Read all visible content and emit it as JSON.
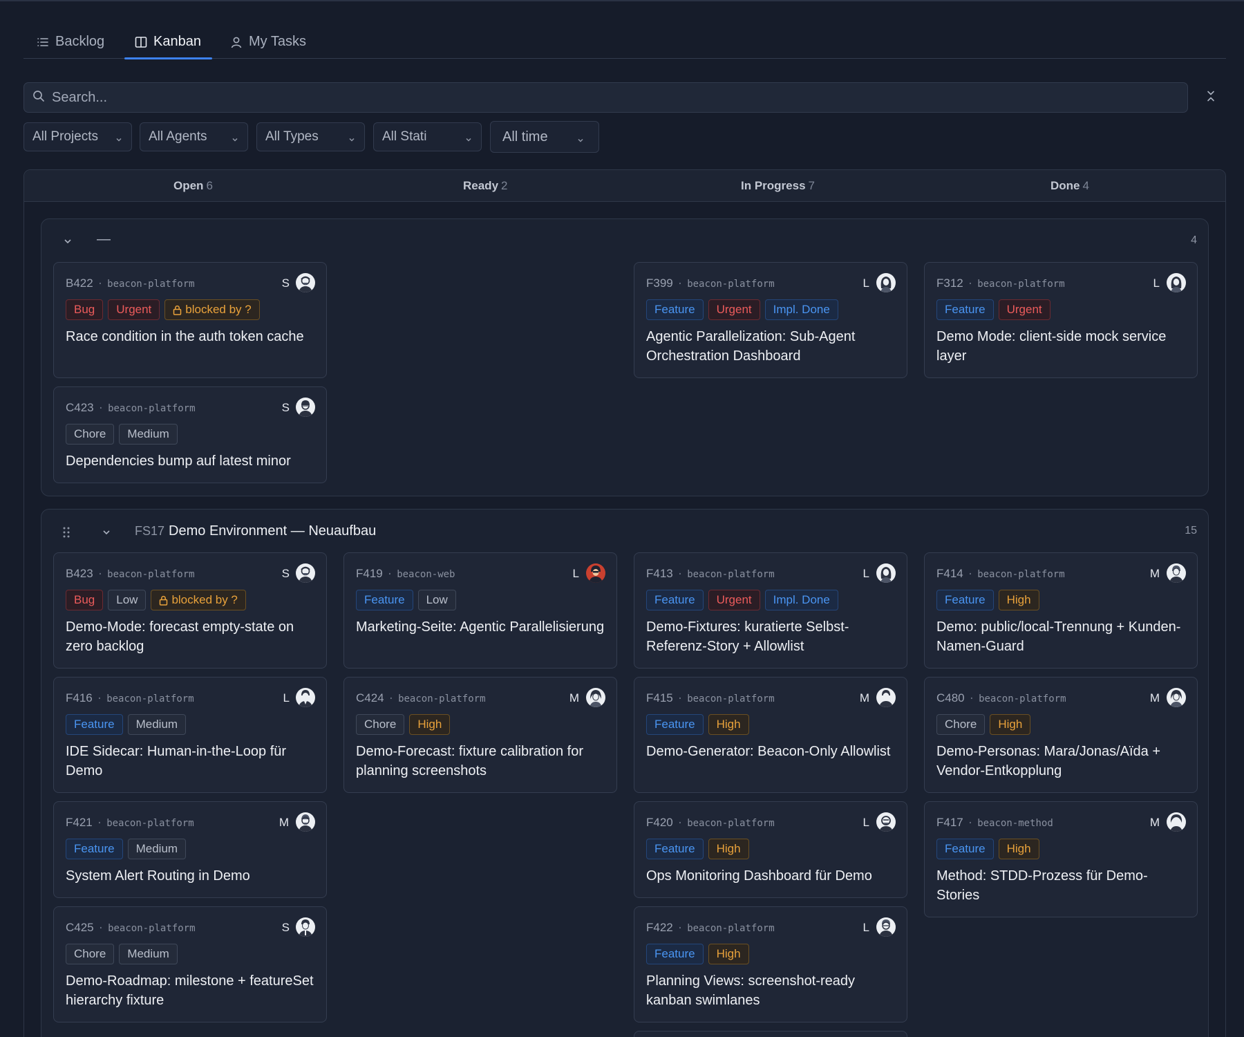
{
  "tabs": [
    {
      "label": "Backlog",
      "icon": "list-icon"
    },
    {
      "label": "Kanban",
      "icon": "columns-icon",
      "active": true
    },
    {
      "label": "My Tasks",
      "icon": "user-icon"
    }
  ],
  "search": {
    "placeholder": "Search..."
  },
  "filters": [
    "All Projects",
    "All Agents",
    "All Types",
    "All Stati",
    "All time"
  ],
  "columns": [
    {
      "name": "Open",
      "count": "6"
    },
    {
      "name": "Ready",
      "count": "2"
    },
    {
      "name": "In Progress",
      "count": "7"
    },
    {
      "name": "Done",
      "count": "4"
    }
  ],
  "lanes": [
    {
      "id": "",
      "title": "—",
      "count": "4",
      "cards": [
        {
          "id": "B422",
          "project": "beacon-platform",
          "size": "S",
          "tags": [
            "Bug",
            "Urgent",
            "blocked by ?"
          ],
          "title": "Race condition in the auth token cache",
          "column": "Open"
        },
        {
          "id": "C423",
          "project": "beacon-platform",
          "size": "S",
          "tags": [
            "Chore",
            "Medium"
          ],
          "title": "Dependencies bump auf latest minor",
          "column": "Open"
        },
        {
          "id": "F399",
          "project": "beacon-platform",
          "size": "L",
          "tags": [
            "Feature",
            "Urgent",
            "Impl. Done"
          ],
          "title": "Agentic Parallelization: Sub-Agent Orchestration Dashboard",
          "column": "In Progress"
        },
        {
          "id": "F312",
          "project": "beacon-platform",
          "size": "L",
          "tags": [
            "Feature",
            "Urgent"
          ],
          "title": "Demo Mode: client-side mock service layer",
          "column": "Done"
        }
      ]
    },
    {
      "id": "FS17",
      "title": "Demo Environment — Neuaufbau",
      "count": "15",
      "cards": [
        {
          "id": "B423",
          "project": "beacon-platform",
          "size": "S",
          "tags": [
            "Bug",
            "Low",
            "blocked by ?"
          ],
          "title": "Demo-Mode: forecast empty-state on zero backlog",
          "column": "Open"
        },
        {
          "id": "F416",
          "project": "beacon-platform",
          "size": "L",
          "tags": [
            "Feature",
            "Medium"
          ],
          "title": "IDE Sidecar: Human-in-the-Loop für Demo",
          "column": "Open"
        },
        {
          "id": "F421",
          "project": "beacon-platform",
          "size": "M",
          "tags": [
            "Feature",
            "Medium"
          ],
          "title": "System Alert Routing in Demo",
          "column": "Open"
        },
        {
          "id": "C425",
          "project": "beacon-platform",
          "size": "S",
          "tags": [
            "Chore",
            "Medium"
          ],
          "title": "Demo-Roadmap: milestone + featureSet hierarchy fixture",
          "column": "Open"
        },
        {
          "id": "F419",
          "project": "beacon-web",
          "size": "L",
          "tags": [
            "Feature",
            "Low"
          ],
          "title": "Marketing-Seite: Agentic Parallelisierung",
          "column": "Ready"
        },
        {
          "id": "C424",
          "project": "beacon-platform",
          "size": "M",
          "tags": [
            "Chore",
            "High"
          ],
          "title": "Demo-Forecast: fixture calibration for planning screenshots",
          "column": "Ready"
        },
        {
          "id": "F413",
          "project": "beacon-platform",
          "size": "L",
          "tags": [
            "Feature",
            "Urgent",
            "Impl. Done"
          ],
          "title": "Demo-Fixtures: kuratierte Selbst-Referenz-Story + Allowlist",
          "column": "In Progress"
        },
        {
          "id": "F415",
          "project": "beacon-platform",
          "size": "M",
          "tags": [
            "Feature",
            "High"
          ],
          "title": "Demo-Generator: Beacon-Only Allowlist",
          "column": "In Progress"
        },
        {
          "id": "F420",
          "project": "beacon-platform",
          "size": "L",
          "tags": [
            "Feature",
            "High"
          ],
          "title": "Ops Monitoring Dashboard für Demo",
          "column": "In Progress"
        },
        {
          "id": "F422",
          "project": "beacon-platform",
          "size": "L",
          "tags": [
            "Feature",
            "High"
          ],
          "title": "Planning Views: screenshot-ready kanban swimlanes",
          "column": "In Progress"
        },
        {
          "id": "F414",
          "project": "beacon-platform",
          "size": "M",
          "tags": [
            "Feature",
            "High"
          ],
          "title": "Demo: public/local-Trennung + Kunden-Namen-Guard",
          "column": "Done"
        },
        {
          "id": "C480",
          "project": "beacon-platform",
          "size": "M",
          "tags": [
            "Chore",
            "High"
          ],
          "title": "Demo-Personas: Mara/Jonas/Aïda + Vendor-Entkopplung",
          "column": "Done"
        },
        {
          "id": "F417",
          "project": "beacon-method",
          "size": "M",
          "tags": [
            "Feature",
            "High"
          ],
          "title": "Method: STDD-Prozess für Demo-Stories",
          "column": "Done"
        }
      ]
    }
  ],
  "colors": {
    "accent": "#3d82f0",
    "bug": "#ec5b5b",
    "feature": "#4a95f2",
    "high": "#e9a23b"
  }
}
